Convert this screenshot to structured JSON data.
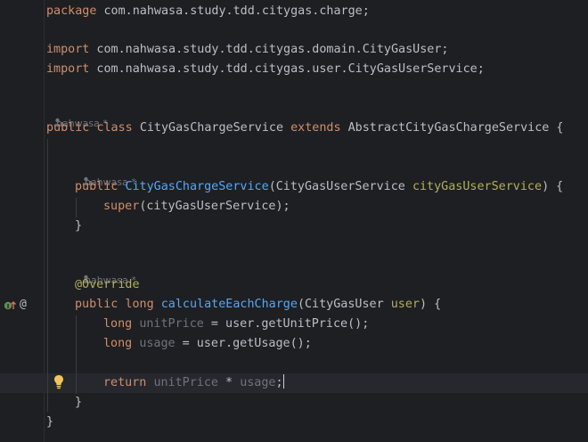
{
  "editor": {
    "line1": {
      "kw": "package",
      "rest": " com.nahwasa.study.tdd.citygas.charge;"
    },
    "line3": {
      "kw": "import",
      "rest": " com.nahwasa.study.tdd.citygas.domain.CityGasUser;"
    },
    "line4": {
      "kw": "import",
      "rest": " com.nahwasa.study.tdd.citygas.user.CityGasUserService;"
    },
    "author_hint": "nahwasa *",
    "class_decl": {
      "kw1": "public",
      "kw2": "class",
      "name": "CityGasChargeService",
      "kw3": "extends",
      "parent": "AbstractCityGasChargeService",
      "brace": " {"
    },
    "ctor": {
      "kw": "public",
      "name": "CityGasChargeService",
      "open": "(CityGasUserService ",
      "param": "cityGasUserService",
      "close": ") {"
    },
    "super_call": {
      "kw": "super",
      "args": "(cityGasUserService);"
    },
    "close_brace": "}",
    "override": "@Override",
    "method": {
      "kw1": "public",
      "kw2": "long",
      "name": "calculateEachCharge",
      "open": "(CityGasUser ",
      "param": "user",
      "close": ") {"
    },
    "stmt1": {
      "kw": "long",
      "var": "unitPrice",
      "rest": " = user.getUnitPrice();"
    },
    "stmt2": {
      "kw": "long",
      "var": "usage",
      "rest": " = user.getUsage();"
    },
    "ret": {
      "kw": "return",
      "var1": "unitPrice",
      "op": " * ",
      "var2": "usage",
      "end": ";"
    },
    "class_close": "}"
  },
  "gutter": {
    "override_marker": "overrides-method-icon",
    "at_marker": "@",
    "intention": "lightbulb-icon"
  },
  "colors": {
    "background": "#1e1f22",
    "keyword": "#cf8e6d",
    "function": "#56a8f5",
    "annotation": "#b3ae60",
    "text": "#bcbec4",
    "muted": "#6f737a",
    "bulb": "#f2c55c"
  }
}
